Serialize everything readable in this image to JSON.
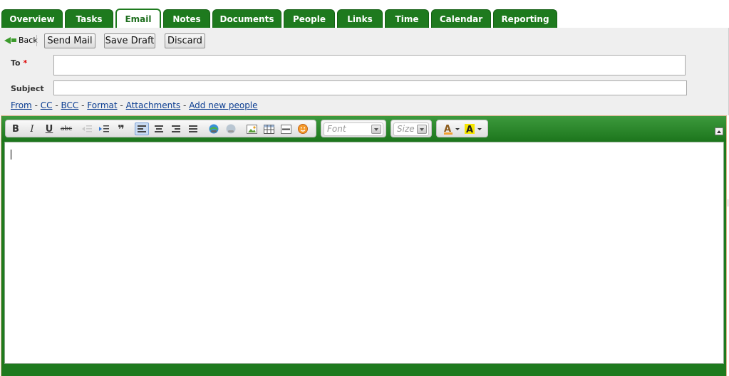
{
  "tabs": [
    {
      "label": "Overview",
      "active": false
    },
    {
      "label": "Tasks",
      "active": false
    },
    {
      "label": "Email",
      "active": true
    },
    {
      "label": "Notes",
      "active": false
    },
    {
      "label": "Documents",
      "active": false
    },
    {
      "label": "People",
      "active": false
    },
    {
      "label": "Links",
      "active": false
    },
    {
      "label": "Time",
      "active": false
    },
    {
      "label": "Calendar",
      "active": false
    },
    {
      "label": "Reporting",
      "active": false
    }
  ],
  "actions": {
    "back": "Back",
    "send": "Send Mail",
    "save_draft": "Save Draft",
    "discard": "Discard"
  },
  "form": {
    "to_label": "To",
    "required_mark": "*",
    "to_value": "",
    "subject_label": "Subject",
    "subject_value": ""
  },
  "options_links": [
    "From",
    "CC",
    "BCC",
    "Format",
    "Attachments",
    "Add new people"
  ],
  "options_separator": "-",
  "editor": {
    "font_placeholder": "Font",
    "size_placeholder": "Size",
    "bold": "B",
    "italic": "I",
    "underline": "U",
    "strike": "abc",
    "quote": "❞",
    "body": ""
  },
  "colors": {
    "brand_green": "#1e7a1e",
    "link_blue": "#0b3d91",
    "required_red": "#dd0000"
  }
}
